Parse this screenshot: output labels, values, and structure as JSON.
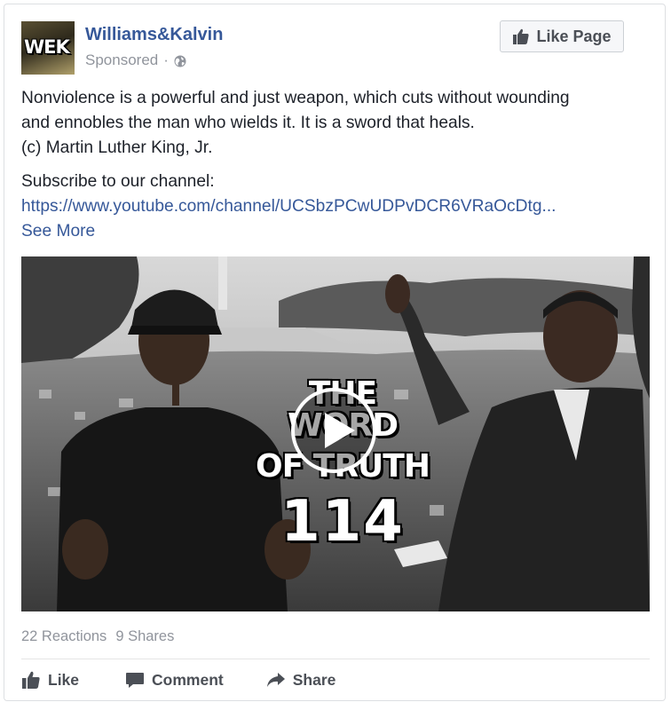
{
  "page": {
    "name": "Williams&Kalvin",
    "avatar_logo": "WEK",
    "sponsored_label": "Sponsored",
    "separator": "·",
    "privacy_icon": "globe-icon",
    "like_page_label": "Like Page"
  },
  "post": {
    "quote_line1": "Nonviolence is a powerful and just weapon, which cuts without wounding",
    "quote_line2": "and ennobles the man who wields it. It is a sword that heals.",
    "quote_line3": "(c) Martin Luther King, Jr.",
    "subscribe_label": "Subscribe to our channel:",
    "channel_link": "https://www.youtube.com/channel/UCSbzPCwUDPvDCR6VRaOcDtg...",
    "see_more_label": "See More"
  },
  "video": {
    "title_line1": "THE WORD",
    "title_line2": "OF TRUTH",
    "title_line3": "114",
    "play_icon": "play-icon"
  },
  "stats": {
    "reactions": "22 Reactions",
    "shares": "9 Shares"
  },
  "actions": {
    "like_label": "Like",
    "comment_label": "Comment",
    "share_label": "Share"
  },
  "colors": {
    "link": "#365899",
    "muted": "#90949c",
    "text": "#1d2129",
    "button_text": "#4b4f56",
    "button_bg": "#f6f7f9",
    "border": "#dddfe2"
  }
}
